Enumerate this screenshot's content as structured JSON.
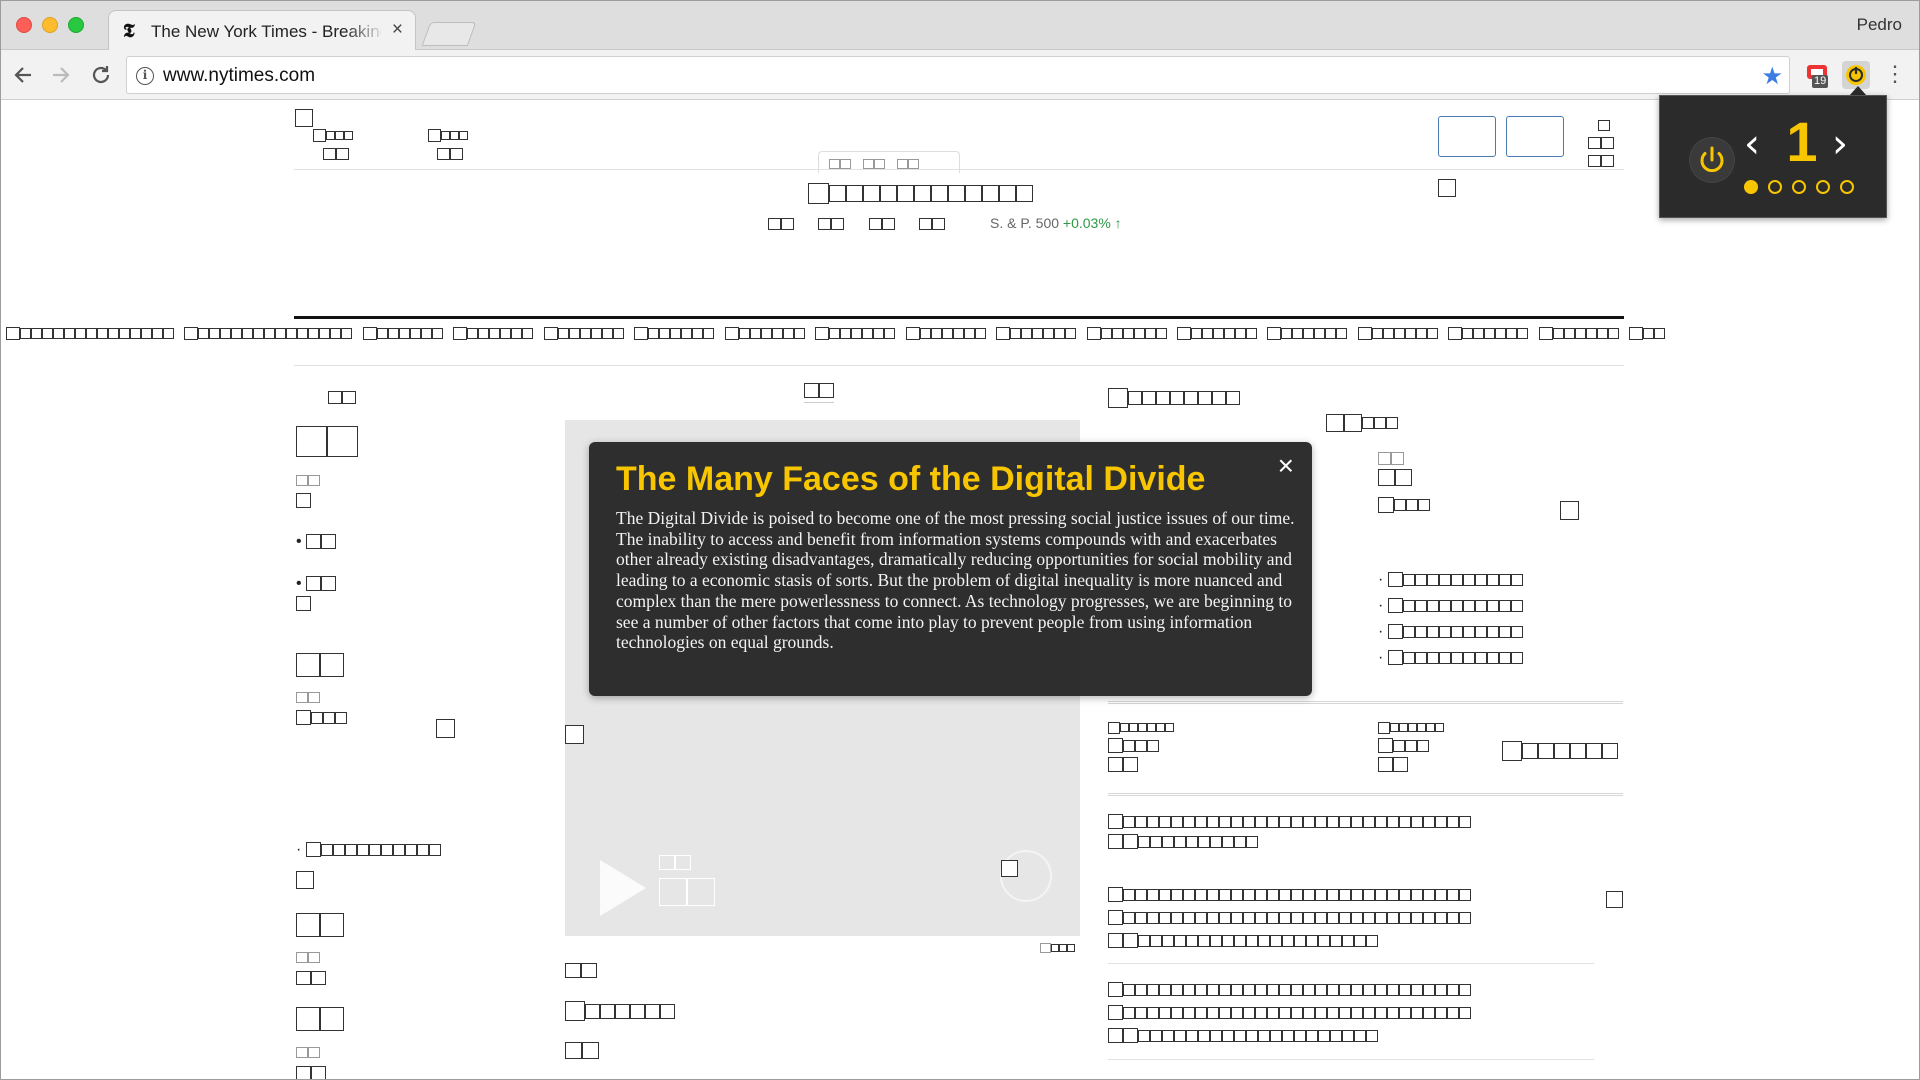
{
  "browser": {
    "tab": {
      "title": "The New York Times - Breaking",
      "favicon": "𝕿",
      "close": "×"
    },
    "user": "Pedro",
    "url": "www.nytimes.com",
    "extension_badge": "19"
  },
  "header": {
    "sp_index_label": "S. & P. 500",
    "sp_index_change": "+0.03% ↑"
  },
  "tooltip": {
    "title": "The Many Faces of the Digital Divide",
    "close": "×",
    "body": "The Digital Divide is poised to become one of the most pressing social justice issues of our time. The inability to access and benefit from information systems compounds with and exacerbates other already existing disadvantages, dramatically reducing opportunities for social mobility and leading to a economic stasis of sorts. But the problem of digital inequality is more nuanced and complex than the mere powerlessness to connect. As technology progresses, we are beginning to see a number of other factors that come into play to prevent people from using information technologies on equal grounds."
  },
  "stepper": {
    "current": "1",
    "prev": "‹",
    "next": "›",
    "total_dots": 5
  },
  "colors": {
    "accent_yellow": "#f7c600",
    "popup_bg": "#2b2b2b",
    "tooltip_bg": "#222222",
    "link_blue": "#4a79b3",
    "positive_green": "#2e9944"
  },
  "icons": [
    "back-arrow-icon",
    "forward-arrow-icon",
    "reload-icon",
    "info-icon",
    "star-icon",
    "extension-icon",
    "power-icon",
    "play-icon",
    "replay-icon",
    "close-icon"
  ]
}
